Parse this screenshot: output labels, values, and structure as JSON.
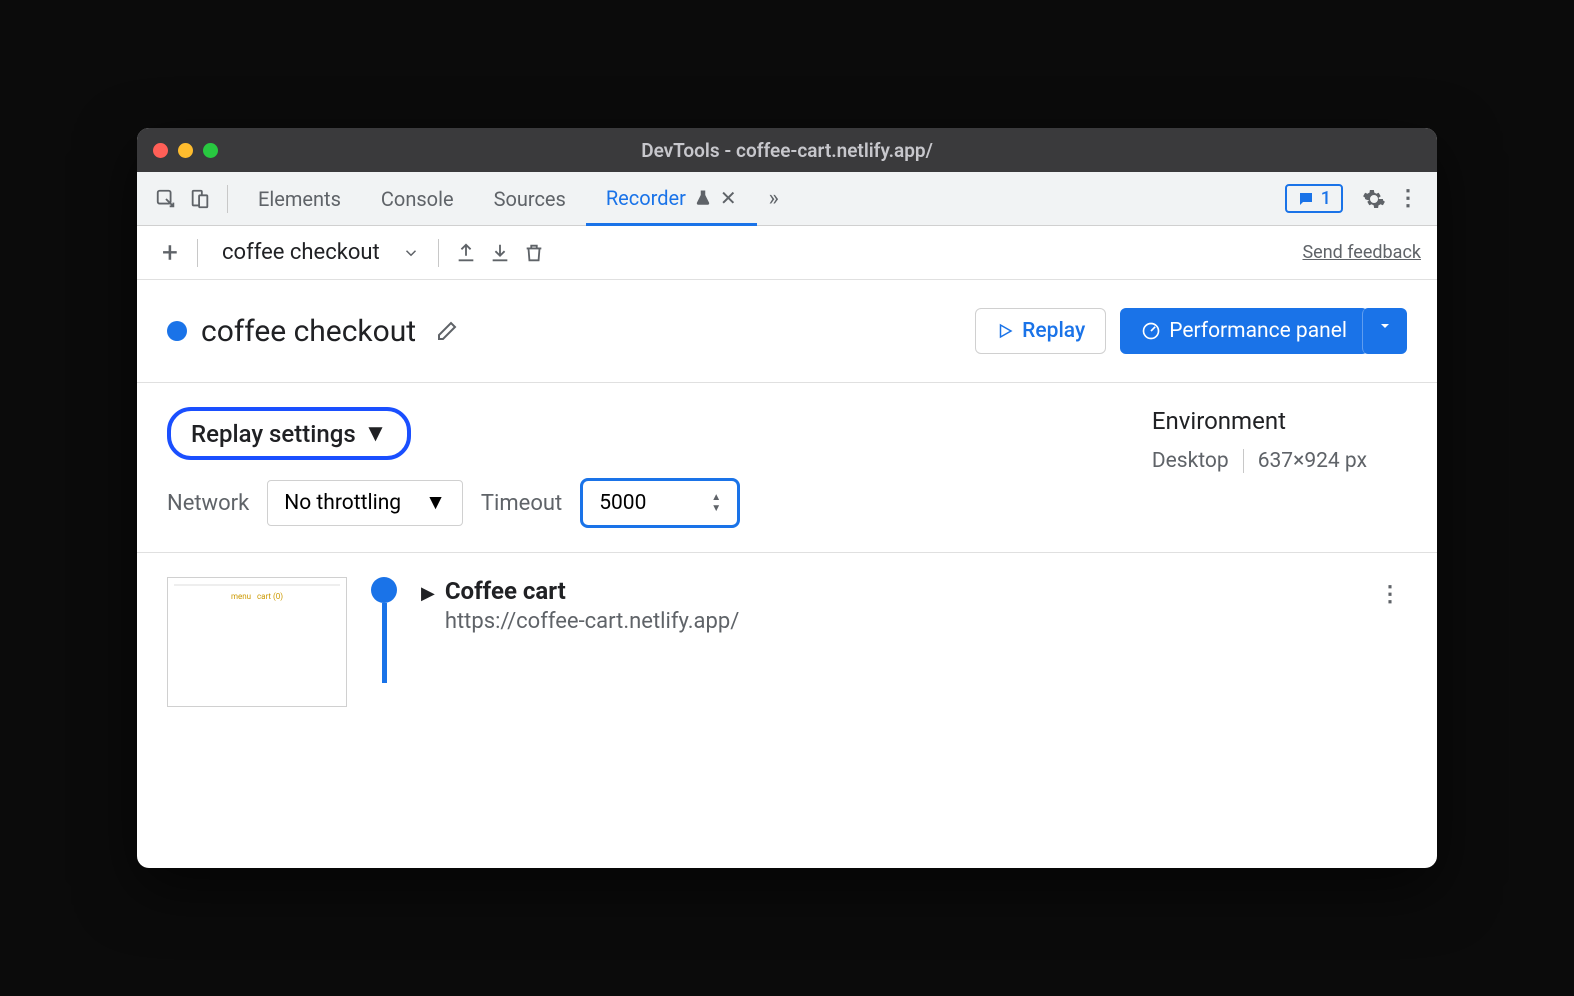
{
  "window": {
    "title": "DevTools - coffee-cart.netlify.app/"
  },
  "tabs": {
    "elements": "Elements",
    "console": "Console",
    "sources": "Sources",
    "recorder": "Recorder"
  },
  "issues": {
    "count": "1"
  },
  "toolbar": {
    "recording_name": "coffee checkout",
    "feedback": "Send feedback"
  },
  "header": {
    "name": "coffee checkout",
    "replay": "Replay",
    "perf": "Performance panel"
  },
  "settings": {
    "replay_label": "Replay settings",
    "network_label": "Network",
    "network_value": "No throttling",
    "timeout_label": "Timeout",
    "timeout_value": "5000",
    "env_title": "Environment",
    "env_device": "Desktop",
    "env_size": "637×924 px"
  },
  "step": {
    "title": "Coffee cart",
    "url": "https://coffee-cart.netlify.app/"
  }
}
